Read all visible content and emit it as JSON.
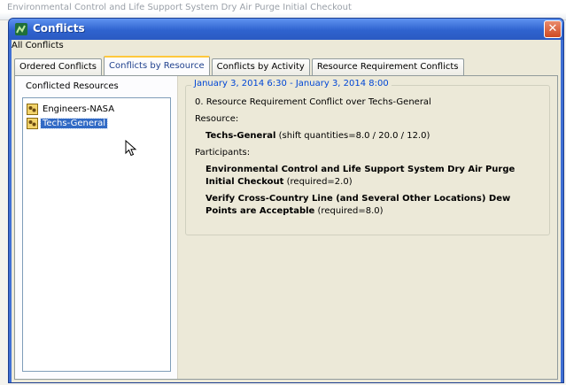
{
  "background": {
    "text": "Environmental Control and Life Support System Dry Air Purge Initial Checkout"
  },
  "window": {
    "title": "Conflicts",
    "close_glyph": "✕"
  },
  "header": {
    "all_conflicts": "All Conflicts"
  },
  "tabs": [
    {
      "label": "Ordered Conflicts",
      "active": false
    },
    {
      "label": "Conflicts by Resource",
      "active": true
    },
    {
      "label": "Conflicts by Activity",
      "active": false
    },
    {
      "label": "Resource Requirement Conflicts",
      "active": false
    }
  ],
  "left": {
    "header": "Conflicted Resources",
    "items": [
      {
        "label": "Engineers-NASA",
        "selected": false,
        "icon": "resource-icon"
      },
      {
        "label": "Techs-General",
        "selected": true,
        "icon": "resource-icon"
      }
    ]
  },
  "detail": {
    "time_range": "January 3, 2014 6:30 - January 3, 2014 8:00",
    "conflict_line": "0. Resource Requirement Conflict over Techs-General",
    "resource_label": "Resource:",
    "resource_name": "Techs-General",
    "resource_info": " (shift quantities=8.0 / 20.0 / 12.0)",
    "participants_label": "Participants:",
    "participants": [
      {
        "name": "Environmental Control and Life Support System Dry Air Purge Initial Checkout",
        "info": " (required=2.0)"
      },
      {
        "name": "Verify Cross-Country Line (and Several Other Locations) Dew Points are Acceptable",
        "info": " (required=8.0)"
      }
    ]
  },
  "colors": {
    "title_blue": "#2f63cf",
    "selection": "#316ac5",
    "group_title": "#0046d5",
    "active_tab_accent": "#ffc83c",
    "close_red": "#cf4a22"
  }
}
